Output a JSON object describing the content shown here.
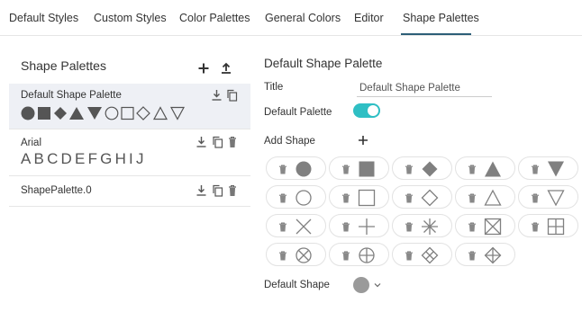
{
  "tabs": [
    {
      "label": "Default Styles",
      "active": false
    },
    {
      "label": "Custom Styles",
      "active": false
    },
    {
      "label": "Color Palettes",
      "active": false
    },
    {
      "label": "General Colors",
      "active": false
    },
    {
      "label": "Editor",
      "active": false
    },
    {
      "label": "Shape Palettes",
      "active": true
    }
  ],
  "left_panel": {
    "title": "Shape Palettes",
    "icons": [
      "add-icon",
      "upload-icon"
    ],
    "items": [
      {
        "name": "Default Shape Palette",
        "selected": true,
        "preview": "shapes",
        "icons": [
          "download-icon",
          "copy-icon"
        ]
      },
      {
        "name": "Arial",
        "selected": false,
        "preview_text": "ABCDEFGHIJ",
        "icons": [
          "download-icon",
          "copy-icon",
          "trash-icon"
        ]
      },
      {
        "name": "ShapePalette.0",
        "selected": false,
        "icons": [
          "download-icon",
          "copy-icon",
          "trash-icon"
        ]
      }
    ]
  },
  "right_panel": {
    "title": "Default Shape Palette",
    "title_label": "Title",
    "title_value": "Default Shape Palette",
    "default_palette_label": "Default Palette",
    "default_palette_on": true,
    "add_shape_label": "Add Shape",
    "default_shape_label": "Default Shape",
    "shapes": [
      "circle-filled",
      "square-filled",
      "diamond-filled",
      "triangle-up-filled",
      "triangle-down-filled",
      "circle-outline",
      "square-outline",
      "diamond-outline",
      "triangle-up-outline",
      "triangle-down-outline",
      "x-cross",
      "plus",
      "asterisk",
      "square-x",
      "square-plus",
      "circle-x",
      "circle-plus",
      "diamond-x",
      "diamond-plus"
    ],
    "default_shape": "circle-filled"
  },
  "colors": {
    "accent": "#2fbfc4",
    "tab_underline": "#2c5e77",
    "shape_fill": "#808080",
    "selected_bg": "#eef0f5"
  }
}
